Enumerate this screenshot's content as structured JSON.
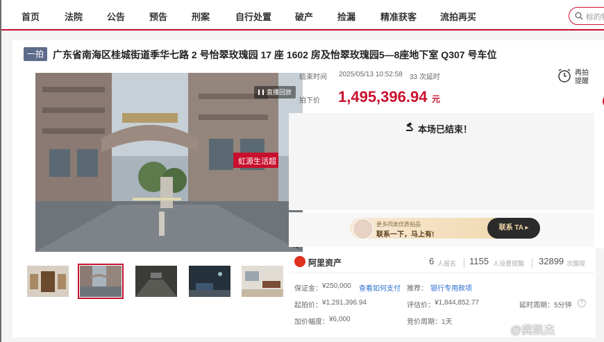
{
  "nav": {
    "items": [
      "首页",
      "法院",
      "公告",
      "预告",
      "刑案",
      "自行处置",
      "破产",
      "捡漏",
      "精准获客",
      "流拍再买"
    ],
    "search_placeholder": "标的物"
  },
  "auction": {
    "tag": "一拍",
    "title": "广东省南海区桂城街道季华七路 2 号怡翠玫瑰园 17 座 1602 房及怡翠玫瑰园5—8座地下室 Q307 号车位",
    "live_tag": "直播回放",
    "end_time_label": "结束时间",
    "end_time": "2025/05/13 10:52:58",
    "delay_count": "33 次延时",
    "price_label": "拍下价",
    "price": "1,495,396.94",
    "price_unit": "元",
    "remind_label_1": "再拍",
    "remind_label_2": "提醒",
    "ended_text": "本场已结束！"
  },
  "banner": {
    "line1": "更多同类优质拍品",
    "line2": "联系一下，马上有!",
    "cta": "联系 TA ▸"
  },
  "platform": {
    "name": "阿里资产",
    "signups": "6",
    "signups_label": "人报名",
    "reminders": "1155",
    "reminders_label": "人设置提醒",
    "views": "32899",
    "views_label": "次围观"
  },
  "details": {
    "deposit_label": "保证金：",
    "deposit": "¥250,000",
    "pay_link": "查看如何支付",
    "recommend_label": "推荐：",
    "recommend_link": "银行专用款项",
    "start_price_label": "起拍价：",
    "start_price": "¥1,291,396.94",
    "appraisal_label": "评估价：",
    "appraisal": "¥1,844,852.77",
    "delay_period_label": "延时周期：",
    "delay_period": "5分钟",
    "increment_label": "加价幅度：",
    "increment": "¥6,000",
    "bid_period_label": "竞价周期：",
    "bid_period": "1天"
  },
  "watermark": "@龚凯杰",
  "colors": {
    "accent": "#c8102e",
    "link": "#2b6fd1",
    "tag": "#5f6b8a"
  }
}
